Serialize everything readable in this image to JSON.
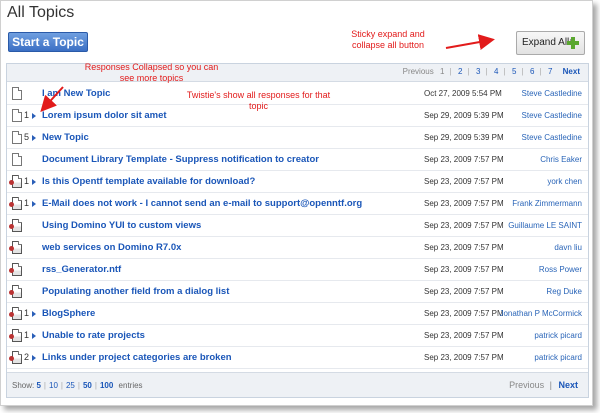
{
  "page": {
    "title": "All Topics"
  },
  "toolbar": {
    "start_topic_label": "Start a Topic",
    "expand_all_label": "Expand All:"
  },
  "annotations": {
    "sticky": "Sticky expand and collapse all button",
    "collapsed": "Responses Collapsed so you can see more topics",
    "twistie": "Twistie's show all responses for that topic"
  },
  "pager_top": {
    "previous": "Previous",
    "pages": [
      "1",
      "2",
      "3",
      "4",
      "5",
      "6",
      "7"
    ],
    "next": "Next"
  },
  "topics": [
    {
      "icon": "document-icon",
      "count": "",
      "twistie": false,
      "title": "I am New Topic",
      "date": "Oct 27, 2009 5:54 PM",
      "author": "Steve Castledine"
    },
    {
      "icon": "document-icon",
      "count": "1",
      "twistie": true,
      "title": "Lorem ipsum dolor sit amet",
      "date": "Sep 29, 2009 5:39 PM",
      "author": "Steve Castledine"
    },
    {
      "icon": "document-icon",
      "count": "5",
      "twistie": true,
      "title": "New Topic",
      "date": "Sep 29, 2009 5:39 PM",
      "author": "Steve Castledine"
    },
    {
      "icon": "document-icon",
      "count": "",
      "twistie": false,
      "title": "Document Library Template - Suppress notification to creator",
      "date": "Sep 23, 2009 7:57 PM",
      "author": "Chris Eaker"
    },
    {
      "icon": "response-document-icon",
      "count": "1",
      "twistie": true,
      "title": "Is this Opentf template available for download?",
      "date": "Sep 23, 2009 7:57 PM",
      "author": "york chen"
    },
    {
      "icon": "response-document-icon",
      "count": "1",
      "twistie": true,
      "title": "E-Mail does not work - I cannot send an e-mail to support@openntf.org",
      "date": "Sep 23, 2009 7:57 PM",
      "author": "Frank Zimmermann"
    },
    {
      "icon": "response-document-icon",
      "count": "",
      "twistie": false,
      "title": "Using Domino YUI to custom views",
      "date": "Sep 23, 2009 7:57 PM",
      "author": "Guillaume LE SAINT"
    },
    {
      "icon": "response-document-icon",
      "count": "",
      "twistie": false,
      "title": "web services on Domino R7.0x",
      "date": "Sep 23, 2009 7:57 PM",
      "author": "davn liu"
    },
    {
      "icon": "response-document-icon",
      "count": "",
      "twistie": false,
      "title": "rss_Generator.ntf",
      "date": "Sep 23, 2009 7:57 PM",
      "author": "Ross Power"
    },
    {
      "icon": "response-document-icon",
      "count": "",
      "twistie": false,
      "title": "Populating another field from a dialog list",
      "date": "Sep 23, 2009 7:57 PM",
      "author": "Reg Duke"
    },
    {
      "icon": "response-document-icon",
      "count": "1",
      "twistie": true,
      "title": "BlogSphere",
      "date": "Sep 23, 2009 7:57 PM",
      "author": "Jonathan P McCormick"
    },
    {
      "icon": "response-document-icon",
      "count": "1",
      "twistie": true,
      "title": "Unable to rate projects",
      "date": "Sep 23, 2009 7:57 PM",
      "author": "patrick picard"
    },
    {
      "icon": "response-document-icon",
      "count": "2",
      "twistie": true,
      "title": "Links under project categories are broken",
      "date": "Sep 23, 2009 7:57 PM",
      "author": "patrick picard"
    }
  ],
  "footer": {
    "show_label": "Show:",
    "sizes": [
      "5",
      "10",
      "25",
      "50",
      "100"
    ],
    "entries_label": "entries",
    "previous": "Previous",
    "separator": "|",
    "next": "Next"
  },
  "colors": {
    "annotation": "#e21b1b",
    "link": "#1a56b8",
    "button": "#3b6fc4",
    "expand_plus": "#5aa72f"
  }
}
